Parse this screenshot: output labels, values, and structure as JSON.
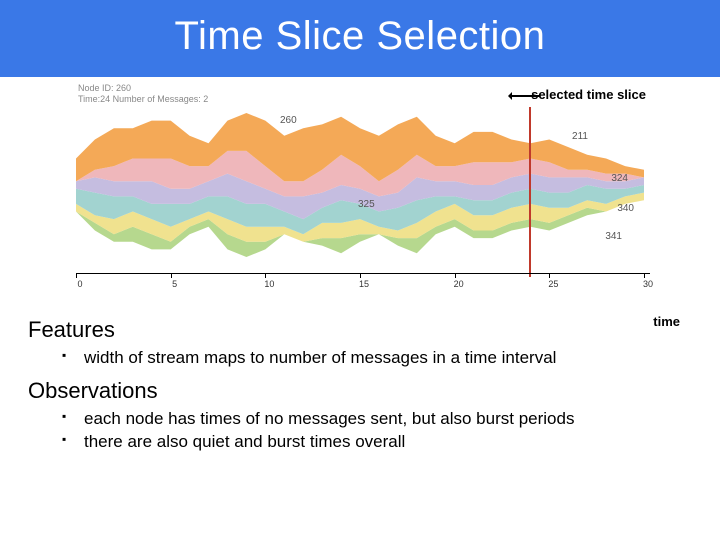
{
  "title": "Time Slice Selection",
  "chart_meta": {
    "node_line": "Node ID: 260",
    "time_line": "Time:24  Number of Messages: 2"
  },
  "annotations": {
    "selected_time_slice": "selected time slice",
    "time_axis": "time"
  },
  "sections": {
    "features_h": "Features",
    "observations_h": "Observations"
  },
  "bullets": {
    "feat1": "width of stream maps to number of messages in a time interval",
    "obs1": "each node has times of no messages sent, but also burst periods",
    "obs2": "there are also quiet and burst times overall"
  },
  "chart_data": {
    "type": "area",
    "title": "",
    "xlabel": "time",
    "ylabel": "",
    "xlim": [
      0,
      30
    ],
    "x_ticks": [
      0,
      5,
      10,
      15,
      20,
      25,
      30
    ],
    "selected_x": 24,
    "colors": {
      "260": "#f4a957",
      "211": "#efb7bb",
      "324": "#c5bde0",
      "325": "#a2d3d0",
      "340": "#f0e28f",
      "341": "#b6d88e"
    },
    "x": [
      0,
      1,
      2,
      3,
      4,
      5,
      6,
      7,
      8,
      9,
      10,
      11,
      12,
      13,
      14,
      15,
      16,
      17,
      18,
      19,
      20,
      21,
      22,
      23,
      24,
      25,
      26,
      27,
      28,
      29,
      30
    ],
    "series": [
      {
        "name": "260",
        "values": [
          3,
          4,
          5,
          4,
          5,
          5,
          4,
          3,
          4,
          5,
          6,
          6,
          7,
          6,
          5,
          5,
          6,
          6,
          5,
          4,
          3,
          4,
          4,
          3,
          2,
          3,
          3,
          2,
          2,
          1,
          1
        ]
      },
      {
        "name": "211",
        "values": [
          0,
          1,
          2,
          3,
          3,
          4,
          3,
          2,
          3,
          4,
          3,
          2,
          2,
          3,
          4,
          3,
          2,
          3,
          3,
          2,
          2,
          3,
          3,
          2,
          2,
          2,
          1,
          1,
          1,
          1,
          0
        ]
      },
      {
        "name": "324",
        "values": [
          1,
          2,
          2,
          2,
          3,
          2,
          2,
          2,
          3,
          3,
          2,
          2,
          3,
          2,
          2,
          2,
          2,
          2,
          3,
          2,
          2,
          2,
          2,
          2,
          2,
          2,
          2,
          1,
          1,
          1,
          1
        ]
      },
      {
        "name": "325",
        "values": [
          2,
          3,
          3,
          2,
          2,
          3,
          2,
          2,
          3,
          3,
          3,
          2,
          2,
          2,
          3,
          2,
          2,
          3,
          3,
          2,
          1,
          2,
          2,
          2,
          2,
          2,
          2,
          2,
          2,
          1,
          1
        ]
      },
      {
        "name": "340",
        "values": [
          1,
          1,
          2,
          2,
          2,
          2,
          1,
          1,
          2,
          2,
          2,
          1,
          1,
          2,
          2,
          2,
          1,
          1,
          2,
          2,
          2,
          2,
          2,
          2,
          2,
          2,
          1,
          1,
          1,
          1,
          1
        ]
      },
      {
        "name": "341",
        "values": [
          0,
          1,
          1,
          2,
          2,
          1,
          1,
          1,
          2,
          2,
          1,
          0,
          0,
          1,
          2,
          1,
          0,
          1,
          2,
          1,
          1,
          1,
          1,
          1,
          1,
          1,
          1,
          1,
          0,
          0,
          0
        ]
      }
    ]
  }
}
